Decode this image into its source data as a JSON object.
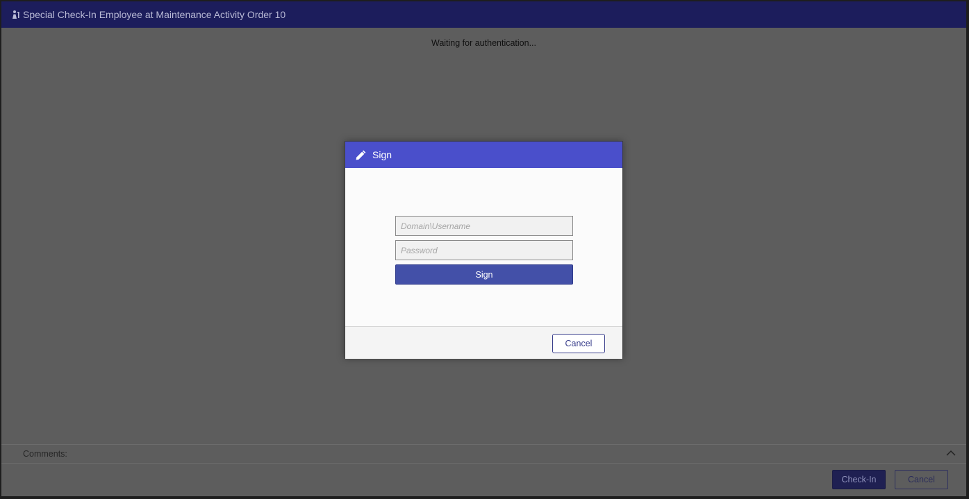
{
  "window": {
    "title": "Special Check-In Employee at Maintenance Activity Order 10",
    "title_icon": "person-check-icon",
    "status_text": "Waiting for authentication..."
  },
  "comments": {
    "label": "Comments:",
    "toggle_icon": "chevron-up-icon"
  },
  "footer": {
    "checkin_label": "Check-In",
    "cancel_label": "Cancel"
  },
  "dialog": {
    "title": "Sign",
    "title_icon": "pencil-icon",
    "username_placeholder": "Domain\\Username",
    "password_placeholder": "Password",
    "sign_label": "Sign",
    "cancel_label": "Cancel"
  },
  "colors": {
    "title_bar": "#1c1d5c",
    "dialog_header": "#4a4fcb",
    "sign_button": "#4350a8",
    "overlay": "#5d5d5d"
  }
}
